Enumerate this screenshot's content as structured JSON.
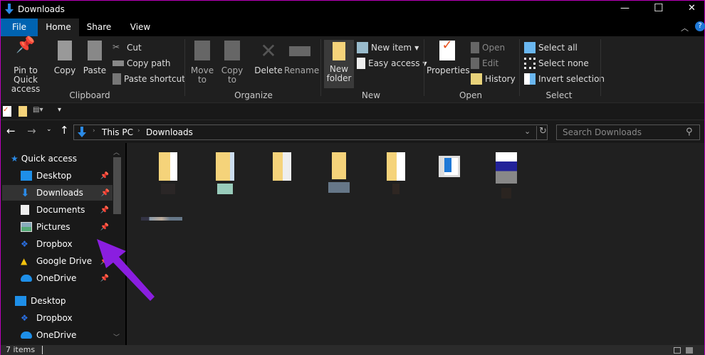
{
  "window": {
    "title": "Downloads",
    "minimize": "—",
    "maximize": "☐",
    "close": "✕"
  },
  "tabs": [
    {
      "label": "File"
    },
    {
      "label": "Home"
    },
    {
      "label": "Share"
    },
    {
      "label": "View"
    }
  ],
  "ribbon": {
    "clipboard": {
      "label": "Clipboard",
      "pin": "Pin to Quick access",
      "copy": "Copy",
      "paste": "Paste",
      "cut": "Cut",
      "copy_path": "Copy path",
      "paste_shortcut": "Paste shortcut"
    },
    "organize": {
      "label": "Organize",
      "move_to": "Move to",
      "copy_to": "Copy to",
      "delete": "Delete",
      "rename": "Rename"
    },
    "new": {
      "label": "New",
      "new_folder": "New folder",
      "new_item": "New item",
      "easy_access": "Easy access"
    },
    "open": {
      "label": "Open",
      "properties": "Properties",
      "open": "Open",
      "edit": "Edit",
      "history": "History"
    },
    "select": {
      "label": "Select",
      "select_all": "Select all",
      "select_none": "Select none",
      "invert": "Invert selection"
    }
  },
  "address": {
    "path": [
      "This PC",
      "Downloads"
    ],
    "search_placeholder": "Search Downloads"
  },
  "nav": {
    "quick_access": "Quick access",
    "items": [
      {
        "label": "Desktop",
        "icon": "desktop-icon",
        "pinned": true
      },
      {
        "label": "Downloads",
        "icon": "downloads-icon",
        "pinned": true,
        "selected": true
      },
      {
        "label": "Documents",
        "icon": "documents-icon",
        "pinned": true
      },
      {
        "label": "Pictures",
        "icon": "pictures-icon",
        "pinned": true
      },
      {
        "label": "Dropbox",
        "icon": "dropbox-icon",
        "pinned": true
      },
      {
        "label": "Google Drive",
        "icon": "google-drive-icon",
        "pinned": true
      },
      {
        "label": "OneDrive",
        "icon": "onedrive-icon",
        "pinned": true
      }
    ],
    "desktop": "Desktop",
    "desktop_items": [
      {
        "label": "Dropbox",
        "icon": "dropbox-icon"
      },
      {
        "label": "OneDrive",
        "icon": "onedrive-icon"
      }
    ]
  },
  "files": [
    {
      "icon": "folder-icon"
    },
    {
      "icon": "folder-icon"
    },
    {
      "icon": "folder-icon"
    },
    {
      "icon": "folder-icon"
    },
    {
      "icon": "folder-icon"
    },
    {
      "icon": "window-app-icon"
    },
    {
      "icon": "installer-icon"
    },
    {
      "icon": "blank-file-icon"
    }
  ],
  "status": {
    "count": "7 items"
  },
  "colors": {
    "accent": "#0063b1",
    "arrow": "#8a1ee0",
    "folder": "#f5d37a"
  }
}
